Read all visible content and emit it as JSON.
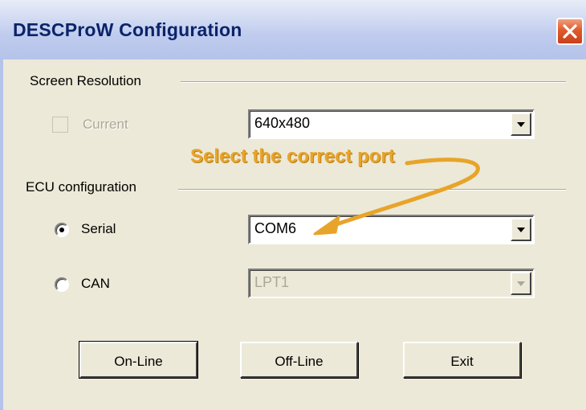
{
  "window": {
    "title": "DESCProW Configuration"
  },
  "screen_resolution": {
    "group_label": "Screen Resolution",
    "current_checkbox_label": "Current",
    "current_checked": false,
    "resolution_value": "640x480"
  },
  "annotation": {
    "text": "Select the correct port",
    "color": "#e8a42a"
  },
  "ecu_config": {
    "group_label": "ECU configuration",
    "serial_label": "Serial",
    "serial_selected": true,
    "serial_port_value": "COM6",
    "can_label": "CAN",
    "can_selected": false,
    "can_port_value": "LPT1"
  },
  "buttons": {
    "online": "On-Line",
    "offline": "Off-Line",
    "exit": "Exit"
  },
  "icons": {
    "close": "close-icon",
    "dropdown": "chevron-down-icon"
  }
}
